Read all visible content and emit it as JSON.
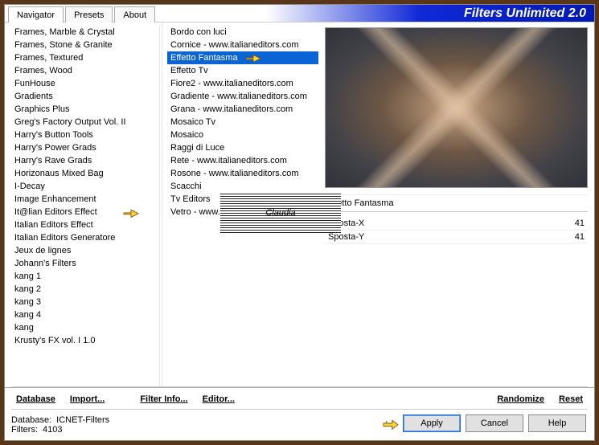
{
  "title": "Filters Unlimited 2.0",
  "tabs": [
    "Navigator",
    "Presets",
    "About"
  ],
  "active_tab": 0,
  "left_list": [
    "Frames, Marble & Crystal",
    "Frames, Stone & Granite",
    "Frames, Textured",
    "Frames, Wood",
    "FunHouse",
    "Gradients",
    "Graphics Plus",
    "Greg's Factory Output Vol. II",
    "Harry's Button Tools",
    "Harry's Power Grads",
    "Harry's Rave Grads",
    "Horizonaus Mixed Bag",
    "I-Decay",
    "Image Enhancement",
    "It@lian Editors Effect",
    "Italian Editors Effect",
    "Italian Editors Generatore",
    "Jeux de lignes",
    "Johann's Filters",
    "kang 1",
    "kang 2",
    "kang 3",
    "kang 4",
    "kang",
    "Krusty's FX vol. I 1.0"
  ],
  "left_highlight_index": 14,
  "mid_list": [
    "Bordo con luci",
    "Cornice - www.italianeditors.com",
    "Effetto Fantasma",
    "Effetto Tv",
    "Fiore2 - www.italianeditors.com",
    "Gradiente - www.italianeditors.com",
    "Grana - www.italianeditors.com",
    "Mosaico Tv",
    "Mosaico",
    "Raggi di Luce",
    "Rete - www.italianeditors.com",
    "Rosone - www.italianeditors.com",
    "Scacchi",
    "Tv Editors",
    "Vetro - www.italianeditors.com"
  ],
  "mid_selected_index": 2,
  "watermark_text": "Claudia",
  "selected_filter": "Effetto Fantasma",
  "params": [
    {
      "name": "Sposta-X",
      "value": "41"
    },
    {
      "name": "Sposta-Y",
      "value": "41"
    }
  ],
  "action_links": {
    "database": "Database",
    "import": "Import...",
    "filter_info": "Filter Info...",
    "editor": "Editor...",
    "randomize": "Randomize",
    "reset": "Reset"
  },
  "status": {
    "db_label": "Database:",
    "db_value": "ICNET-Filters",
    "filters_label": "Filters:",
    "filters_value": "4103"
  },
  "buttons": {
    "apply": "Apply",
    "cancel": "Cancel",
    "help": "Help"
  }
}
